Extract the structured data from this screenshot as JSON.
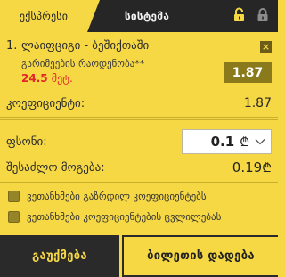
{
  "tabs": {
    "active_label": "ექსპრესი",
    "inactive_label": "სისტემა"
  },
  "header_icons": [
    "unlock-icon",
    "lock-icon"
  ],
  "bet": {
    "number": "1.",
    "match": "ლაიფციგი - ბეშიქთაში",
    "market": "გარიმეების რაოდენობა**",
    "line_value": "24.5",
    "line_unit": "მეტ.",
    "odds": "1.87",
    "close_label": "×"
  },
  "coefficient": {
    "label": "კოეფიციენტი:",
    "value": "1.87"
  },
  "stake": {
    "label": "ფსონი:",
    "amount": "0.1",
    "currency": "₾"
  },
  "possible_win": {
    "label": "შესაძლო მოგება:",
    "value": "0.19",
    "currency": "₾"
  },
  "options": [
    {
      "label": "ვეთანხმები გაზრდილ კოეფიციენტებს"
    },
    {
      "label": "ვეთანხმები კოეფიციენტების ცვლილებას"
    }
  ],
  "buttons": {
    "cancel": "გაუქმება",
    "place": "ბილეთის დადება"
  },
  "colors": {
    "background": "#f6d845",
    "dark": "#262626",
    "odds_box": "#8a7a1c",
    "line_red": "#e2252b"
  }
}
